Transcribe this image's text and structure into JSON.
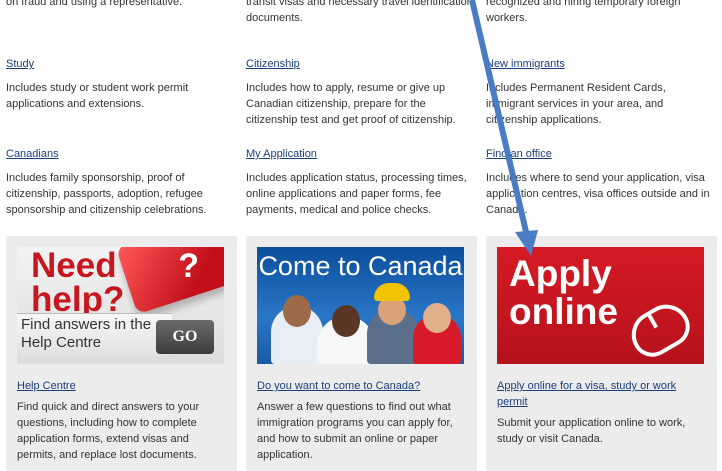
{
  "top_cut": {
    "col1": "on fraud and using a representative.",
    "col2": "transit visas and necessary travel identification",
    "col2b": "documents.",
    "col3": "recognized and hiring temporary foreign workers."
  },
  "topics": [
    {
      "title": "Study",
      "desc": "Includes study or student work permit applications and extensions."
    },
    {
      "title": "Citizenship",
      "desc": "Includes how to apply, resume or give up Canadian citizenship, prepare for the citizenship test and get proof of citizenship."
    },
    {
      "title": "New immigrants",
      "desc": "Includes Permanent Resident Cards, immigrant services in your area, and citizenship applications."
    },
    {
      "title": "Canadians",
      "desc": "Includes family sponsorship, proof of citizenship, passports, adoption, refugee sponsorship and citizenship celebrations."
    },
    {
      "title": "My Application",
      "desc": "Includes application status, processing times, online applications and paper forms, fee payments, medical and police checks."
    },
    {
      "title": "Find an office",
      "desc": "Includes where to send your application, visa application centres, visa offices outside and in Canada."
    }
  ],
  "promos": {
    "help": {
      "banner_title": "Need\nhelp?",
      "banner_sub": "Find answers in the\nHelp Centre",
      "banner_go": "GO",
      "banner_q": "?",
      "link": "Help Centre",
      "desc": "Find quick and direct answers to your questions, including how to complete application forms, extend visas and permits, and replace lost documents."
    },
    "canada": {
      "banner_title": "Come to Canada",
      "link": "Do you want to come to Canada?",
      "desc": "Answer a few questions to find out what immigration programs you can apply for, and how to submit an online or paper application."
    },
    "apply": {
      "banner_title": "Apply\nonline",
      "link": "Apply online for a visa, study or work permit",
      "desc": "Submit your application online to work, study or visit Canada."
    }
  },
  "colors": {
    "link": "#1a3f7a",
    "panel": "#ececec",
    "brand_red": "#c7161e",
    "arrow": "#4a7cc4"
  }
}
